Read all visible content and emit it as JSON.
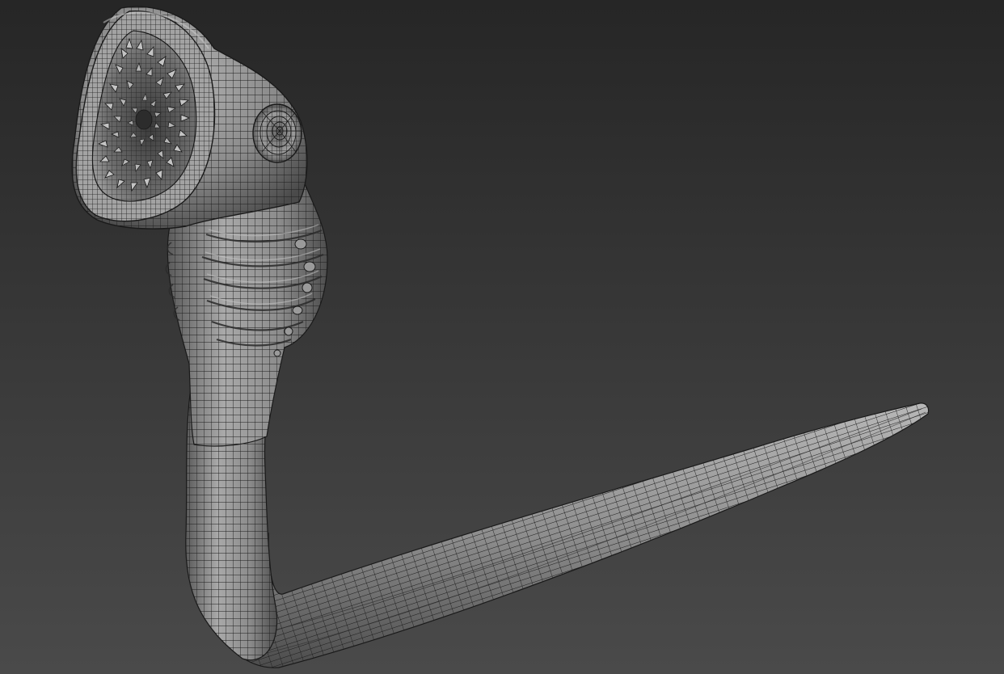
{
  "viewport": {
    "shading": "wireframe-on-shaded",
    "subject": "worm-creature-mesh"
  },
  "colors": {
    "background_top": "#262626",
    "background_bottom": "#4a4a4a",
    "mesh_surface": "#8f8f8f",
    "mesh_highlight": "#c4c4c4",
    "wire": "#1e1e1e"
  }
}
